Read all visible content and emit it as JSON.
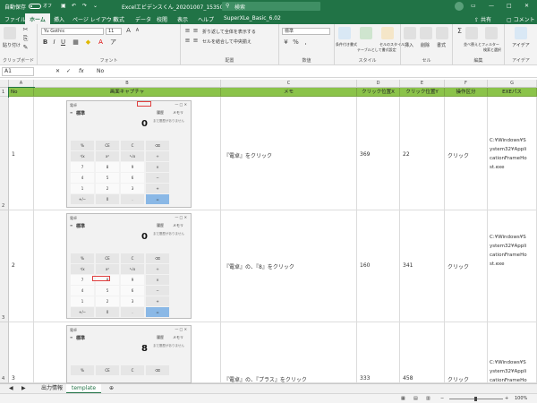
{
  "titlebar": {
    "autosave_label": "自動保存",
    "autosave_state": "オフ",
    "filename": "Excelエビデンスくん_20201007_153504.xlsx",
    "search_placeholder": "検索",
    "account_initials": "",
    "accent_color": "#217346"
  },
  "tabs": [
    "ファイル",
    "ホーム",
    "挿入",
    "ページ レイアウト",
    "数式",
    "データ",
    "校閲",
    "表示",
    "ヘルプ",
    "SuperXLe_Basic_6.02"
  ],
  "active_tab": "ホーム",
  "share_label": "共有",
  "comment_label": "コメント",
  "ribbon": {
    "groups": [
      "クリップボード",
      "フォント",
      "配置",
      "数値",
      "スタイル",
      "セル",
      "編集",
      "アイデア"
    ],
    "font_name": "Yu Gothic",
    "font_size": "11",
    "wrap_text": "折り返して全体を表示する",
    "merge_center": "セルを結合して中央揃え",
    "number_format": "標準",
    "style_buttons": [
      "条件付き書式",
      "テーブルとして書式設定",
      "セルのスタイル"
    ],
    "cell_buttons": [
      "挿入",
      "削除",
      "書式"
    ],
    "edit_buttons": [
      "並べ替えとフィルター",
      "検索と選択"
    ],
    "ideas": "アイデア",
    "paste": "貼り付け"
  },
  "formula_bar": {
    "name_box": "A1",
    "fx": "fx",
    "content": "No"
  },
  "columns": [
    "A",
    "B",
    "C",
    "D",
    "E",
    "F",
    "G"
  ],
  "header_row": [
    "No",
    "画面キャプチャ",
    "メモ",
    "クリック位置X",
    "クリック位置Y",
    "操作区分",
    "EXEパス"
  ],
  "rows": [
    {
      "row_num": "1",
      "no": "1",
      "memo": "『電卓』をクリック",
      "x": "369",
      "y": "22",
      "op": "クリック",
      "exe": "C:¥Windows¥System32¥ApplicationFrameHost.exe",
      "display": "0"
    },
    {
      "row_num": "2",
      "no": "2",
      "memo": "『電卓』の、『8』をクリック",
      "x": "160",
      "y": "341",
      "op": "クリック",
      "exe": "C:¥Windows¥System32¥ApplicationFrameHost.exe",
      "display": "0"
    },
    {
      "row_num": "3",
      "no": "3",
      "memo": "『電卓』の、『プラス』をクリック",
      "x": "333",
      "y": "458",
      "op": "クリック",
      "exe": "C:¥Windows¥System32¥ApplicationFrameHost.exe",
      "display": "8"
    }
  ],
  "row_labels": [
    "1",
    "2",
    "3",
    "4"
  ],
  "calc": {
    "title": "電卓",
    "mode": "標準",
    "history_tab": "履歴",
    "memory_tab": "メモリ",
    "history_empty": "まだ履歴がありません",
    "keys": [
      "%",
      "CE",
      "C",
      "⌫",
      "¹/x",
      "x²",
      "²√x",
      "÷",
      "7",
      "8",
      "9",
      "×",
      "4",
      "5",
      "6",
      "−",
      "1",
      "2",
      "3",
      "+",
      "+/−",
      "0",
      ".",
      "="
    ]
  },
  "sheets": [
    "出力情報",
    "template"
  ],
  "active_sheet": "template",
  "zoom": "100%"
}
